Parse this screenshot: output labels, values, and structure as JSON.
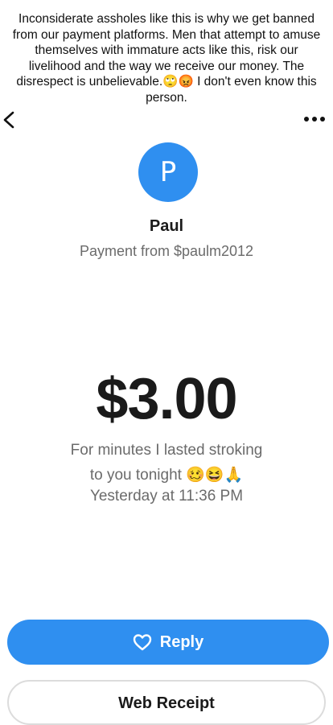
{
  "caption": {
    "text": "Inconsiderate assholes like this is why we get banned from our payment platforms. Men that attempt to amuse themselves with immature acts like this, risk our livelihood and the way we receive our money. The disrespect is unbelievable.🙄😡 I don't even know this person."
  },
  "nav": {
    "back_icon": "chevron-left-icon",
    "more_icon": "more-dots-icon"
  },
  "sender": {
    "initial": "P",
    "name": "Paul",
    "payment_from": "Payment from $paulm2012"
  },
  "payment": {
    "amount": "$3.00",
    "memo_line1": "For minutes I lasted stroking",
    "memo_line2": "to you tonight 🥴😆🙏",
    "timestamp": "Yesterday at 11:36 PM"
  },
  "actions": {
    "reply_label": "Reply",
    "reply_icon": "heart-icon",
    "web_receipt_label": "Web Receipt"
  },
  "colors": {
    "accent": "#2f8ff0",
    "muted_text": "#6b6b6b"
  }
}
